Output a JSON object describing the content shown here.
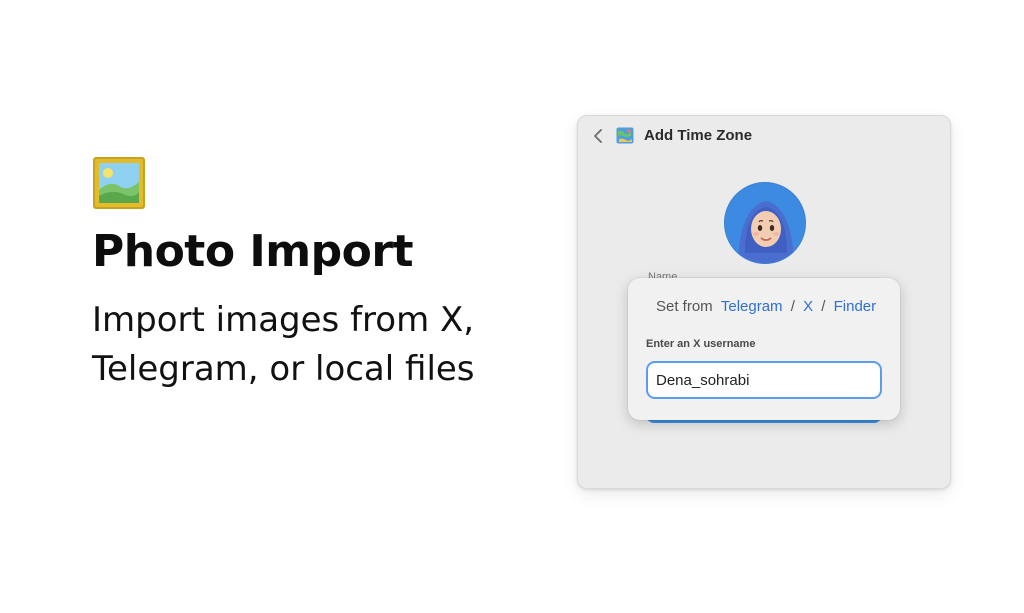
{
  "promo": {
    "icon": "framed-picture-icon",
    "title": "Photo Import",
    "description": "Import images from X, Telegram, or local files"
  },
  "window": {
    "title": "Add Time Zone",
    "back_icon": "chevron-left-icon",
    "title_icon": "map-icon",
    "avatar": "memoji-avatar",
    "name_label": "Name"
  },
  "popover": {
    "set_from_label": "Set from",
    "sources": [
      "Telegram",
      "X",
      "Finder"
    ],
    "separator": "/",
    "input_label": "Enter an X username",
    "input_value": "Dena_sohrabi"
  },
  "colors": {
    "accent": "#2f6fd6",
    "focus_ring": "#5b9cf0",
    "avatar_bg": "#3d8ae3",
    "window_bg": "#ebebec"
  }
}
